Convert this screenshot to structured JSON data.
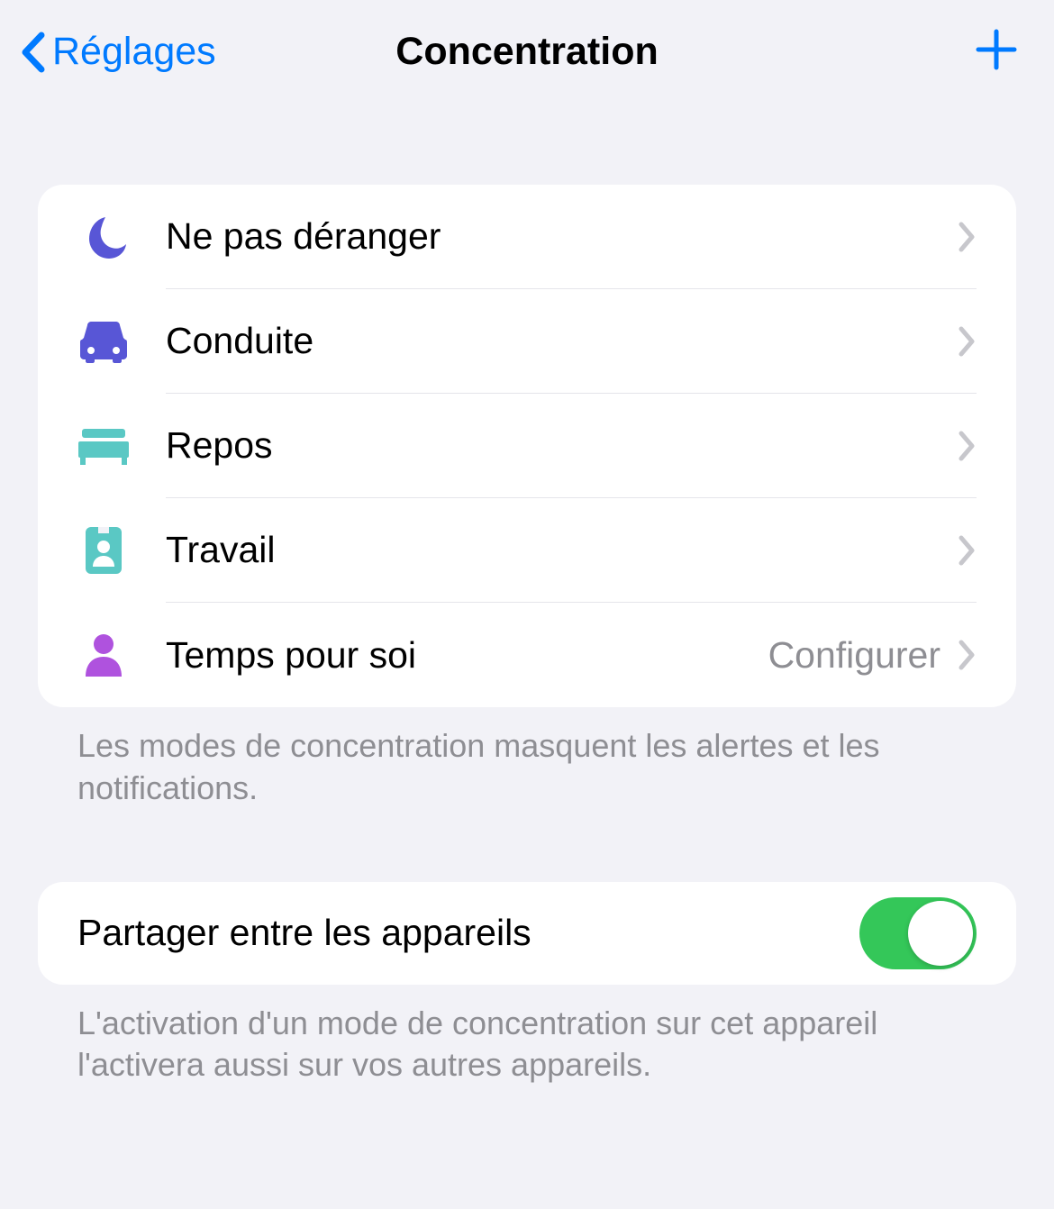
{
  "nav": {
    "back_label": "Réglages",
    "title": "Concentration"
  },
  "focus_modes": [
    {
      "label": "Ne pas déranger",
      "icon": "moon",
      "icon_color": "#5856d6",
      "detail": ""
    },
    {
      "label": "Conduite",
      "icon": "car",
      "icon_color": "#5856d6",
      "detail": ""
    },
    {
      "label": "Repos",
      "icon": "bed",
      "icon_color": "#5ac8c4",
      "detail": ""
    },
    {
      "label": "Travail",
      "icon": "badge",
      "icon_color": "#5ac8c4",
      "detail": ""
    },
    {
      "label": "Temps pour soi",
      "icon": "person",
      "icon_color": "#af52de",
      "detail": "Configurer"
    }
  ],
  "focus_footer": "Les modes de concentration masquent les alertes et les notifications.",
  "share": {
    "label": "Partager entre les appareils",
    "enabled": true
  },
  "share_footer": "L'activation d'un mode de concentration sur cet appareil l'activera aussi sur vos autres appareils."
}
